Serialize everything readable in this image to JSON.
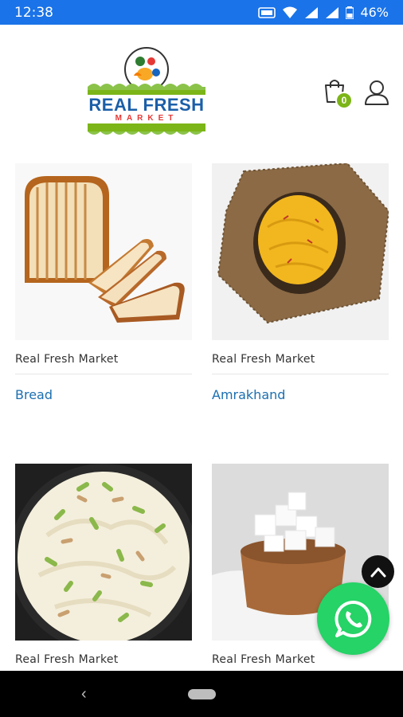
{
  "status": {
    "time": "12:38",
    "battery": "46%"
  },
  "header": {
    "logo_line1": "REAL FRESH",
    "logo_line2": "MARKET",
    "cart_count": "0"
  },
  "products": [
    {
      "vendor": "Real Fresh Market",
      "name": "Bread",
      "image": "bread"
    },
    {
      "vendor": "Real Fresh Market",
      "name": "Amrakhand",
      "image": "amrakhand"
    },
    {
      "vendor": "Real Fresh Market",
      "name": "",
      "image": "shrikhand"
    },
    {
      "vendor": "Real Fresh Market",
      "name": "",
      "image": "paneer"
    }
  ],
  "colors": {
    "status_bar": "#1a73e8",
    "product_link": "#1b6fb0",
    "cart_badge": "#7cb518",
    "whatsapp": "#25d366"
  },
  "icons": [
    "wifi-icon",
    "signal-icon",
    "battery-icon",
    "cart-icon",
    "user-icon",
    "chevron-up-icon",
    "whatsapp-icon",
    "back-icon"
  ]
}
